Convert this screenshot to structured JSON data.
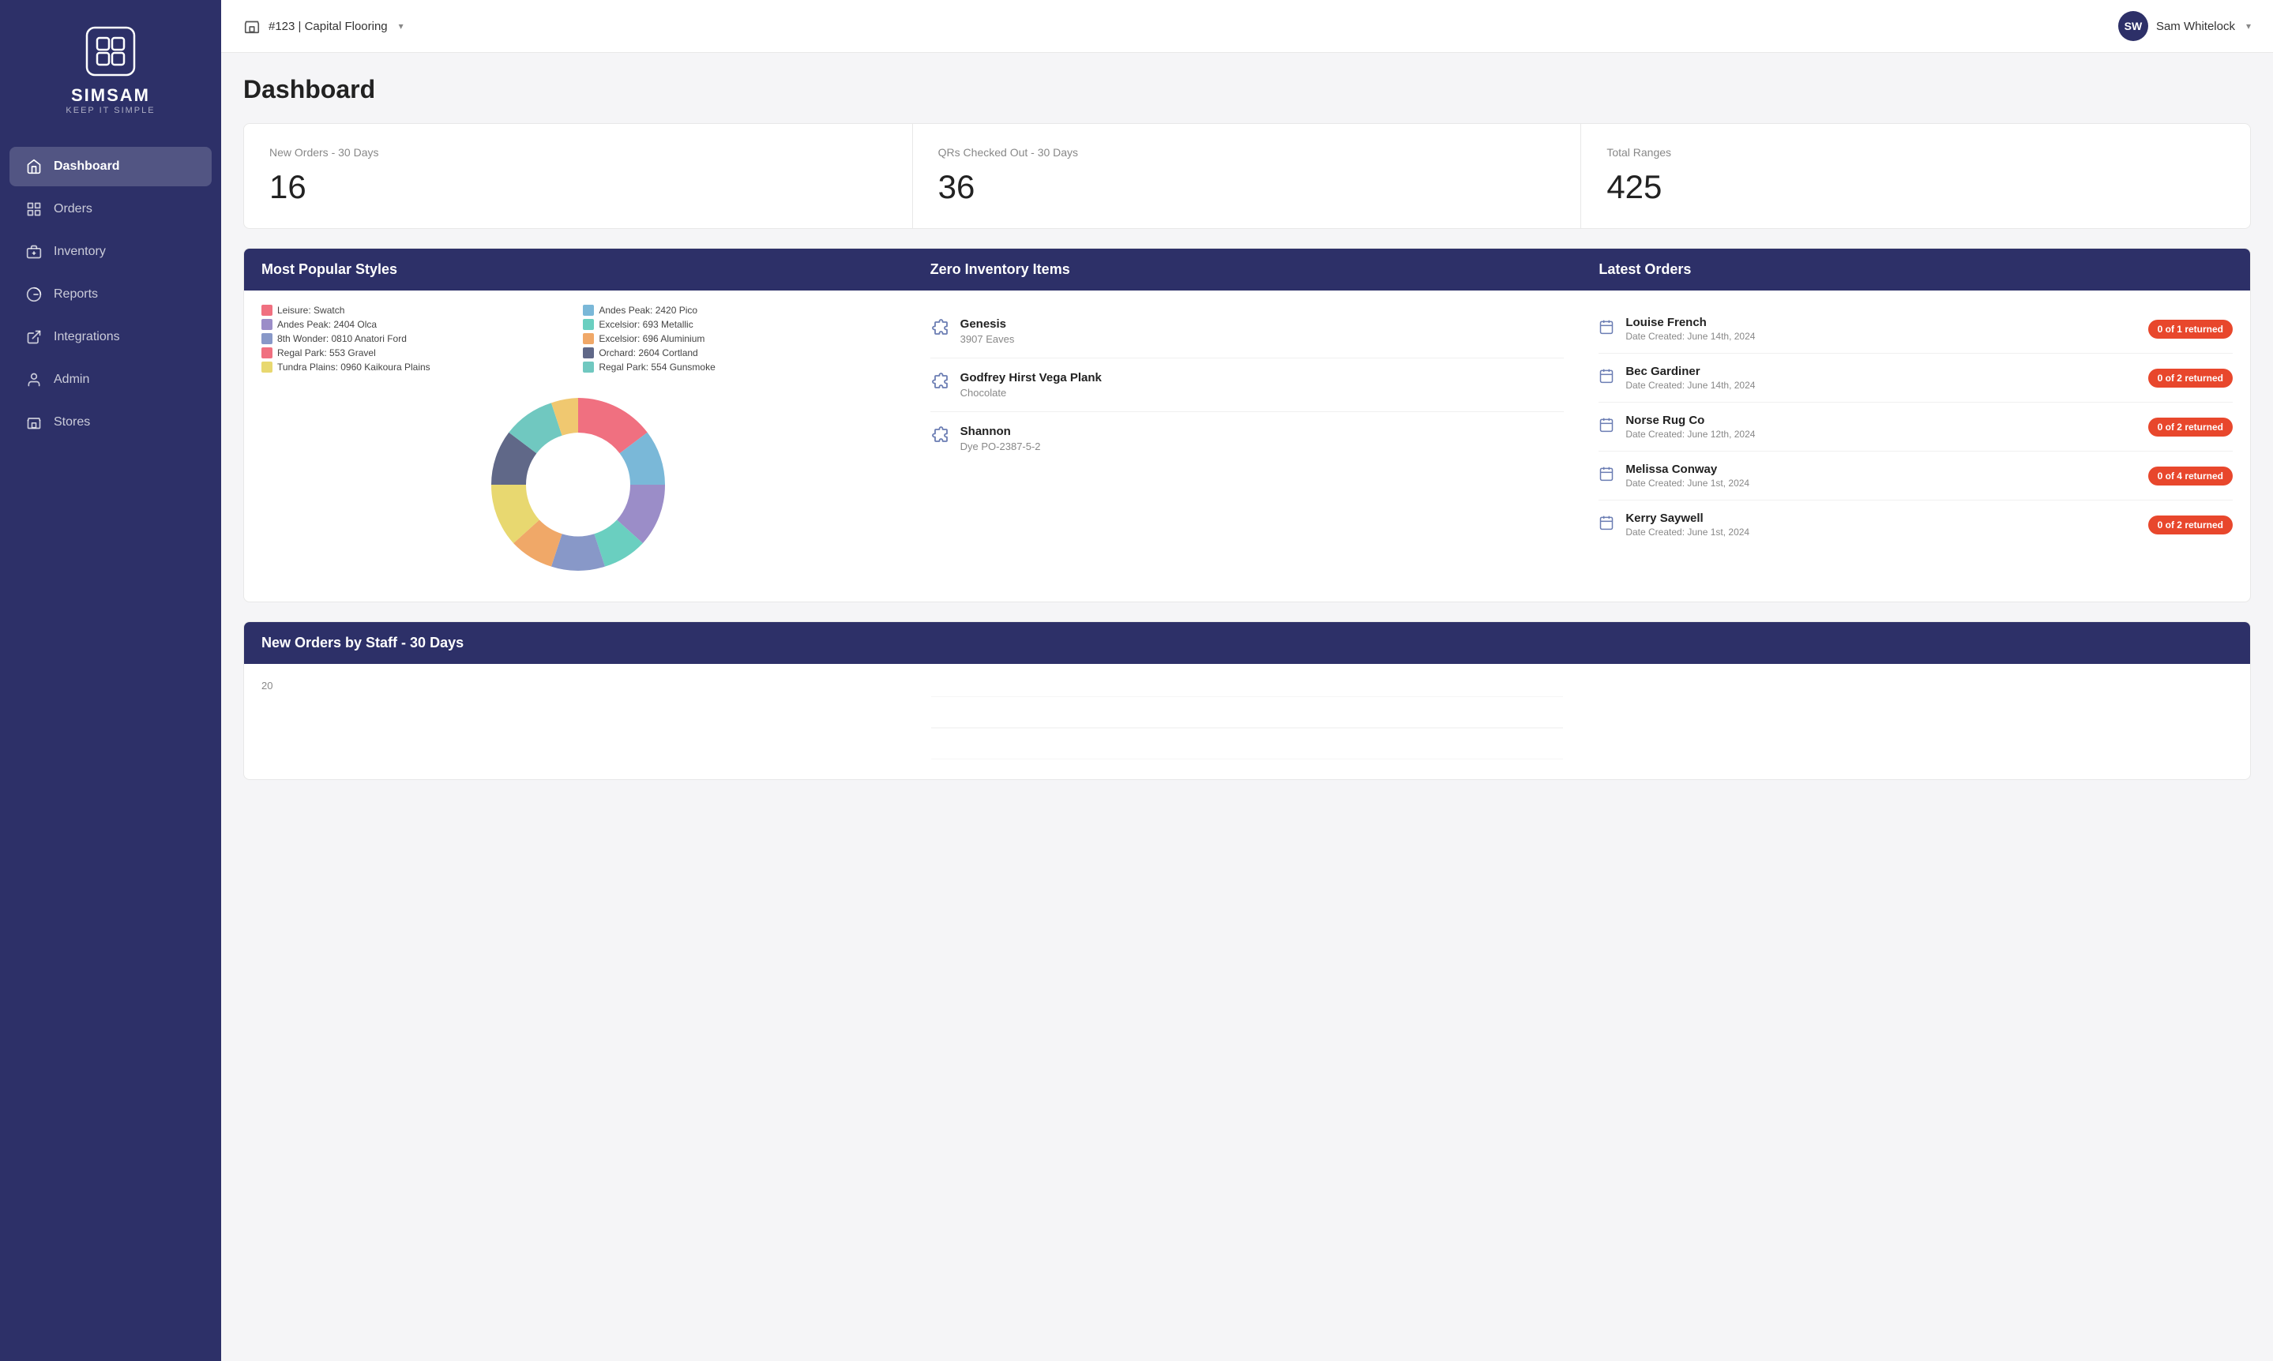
{
  "sidebar": {
    "logo_text": "SIMSAM",
    "logo_sub": "KEEP IT SIMPLE",
    "nav_items": [
      {
        "label": "Dashboard",
        "icon": "home",
        "active": true
      },
      {
        "label": "Orders",
        "icon": "orders",
        "active": false
      },
      {
        "label": "Inventory",
        "icon": "inventory",
        "active": false
      },
      {
        "label": "Reports",
        "icon": "reports",
        "active": false
      },
      {
        "label": "Integrations",
        "icon": "integrations",
        "active": false
      },
      {
        "label": "Admin",
        "icon": "admin",
        "active": false
      },
      {
        "label": "Stores",
        "icon": "stores",
        "active": false
      }
    ]
  },
  "header": {
    "store": "#123 | Capital Flooring",
    "user_initials": "SW",
    "user_name": "Sam Whitelock"
  },
  "page": {
    "title": "Dashboard"
  },
  "stats": [
    {
      "label": "New Orders - 30 Days",
      "value": "16"
    },
    {
      "label": "QRs Checked Out - 30 Days",
      "value": "36"
    },
    {
      "label": "Total Ranges",
      "value": "425"
    }
  ],
  "popular_styles": {
    "title": "Most Popular Styles",
    "legend": [
      {
        "label": "Leisure: Swatch",
        "color": "#f07080"
      },
      {
        "label": "Andes Peak: 2420 Pico",
        "color": "#7ab8d8"
      },
      {
        "label": "Andes Peak: 2404 Olca",
        "color": "#9b8dc8"
      },
      {
        "label": "Excelsior: 693 Metallic",
        "color": "#6acfc0"
      },
      {
        "label": "8th Wonder: 0810 Anatori Ford",
        "color": "#8898c8"
      },
      {
        "label": "Excelsior: 696 Aluminium",
        "color": "#f0a868"
      },
      {
        "label": "Regal Park: 553 Gravel",
        "color": "#f07080"
      },
      {
        "label": "Orchard: 2604 Cortland",
        "color": "#606888"
      },
      {
        "label": "Tundra Plains: 0960 Kaikoura Plains",
        "color": "#e8d870"
      },
      {
        "label": "Regal Park: 554 Gunsmoke",
        "color": "#70c8c0"
      }
    ],
    "chart_segments": [
      {
        "color": "#f07080",
        "pct": 13
      },
      {
        "color": "#7ab8d8",
        "pct": 11
      },
      {
        "color": "#9b8dc8",
        "pct": 10
      },
      {
        "color": "#6acfc0",
        "pct": 9
      },
      {
        "color": "#8898c8",
        "pct": 9
      },
      {
        "color": "#f0a868",
        "pct": 10
      },
      {
        "color": "#e8d870",
        "pct": 9
      },
      {
        "color": "#606888",
        "pct": 9
      },
      {
        "color": "#70c8c0",
        "pct": 10
      },
      {
        "color": "#f0c870",
        "pct": 10
      }
    ]
  },
  "zero_inventory": {
    "title": "Zero Inventory Items",
    "items": [
      {
        "name": "Genesis",
        "sub": "3907 Eaves"
      },
      {
        "name": "Godfrey Hirst Vega Plank",
        "sub": "Chocolate"
      },
      {
        "name": "Shannon",
        "sub": "Dye PO-2387-5-2"
      }
    ]
  },
  "latest_orders": {
    "title": "Latest Orders",
    "orders": [
      {
        "name": "Louise French",
        "date": "Date Created: June 14th, 2024",
        "badge": "0 of 1 returned"
      },
      {
        "name": "Bec Gardiner",
        "date": "Date Created: June 14th, 2024",
        "badge": "0 of 2 returned"
      },
      {
        "name": "Norse Rug Co",
        "date": "Date Created: June 12th, 2024",
        "badge": "0 of 2 returned"
      },
      {
        "name": "Melissa Conway",
        "date": "Date Created: June 1st, 2024",
        "badge": "0 of 4 returned"
      },
      {
        "name": "Kerry Saywell",
        "date": "Date Created: June 1st, 2024",
        "badge": "0 of 2 returned"
      }
    ]
  },
  "staff_orders": {
    "title": "New Orders by Staff - 30 Days",
    "y_label": "20"
  }
}
